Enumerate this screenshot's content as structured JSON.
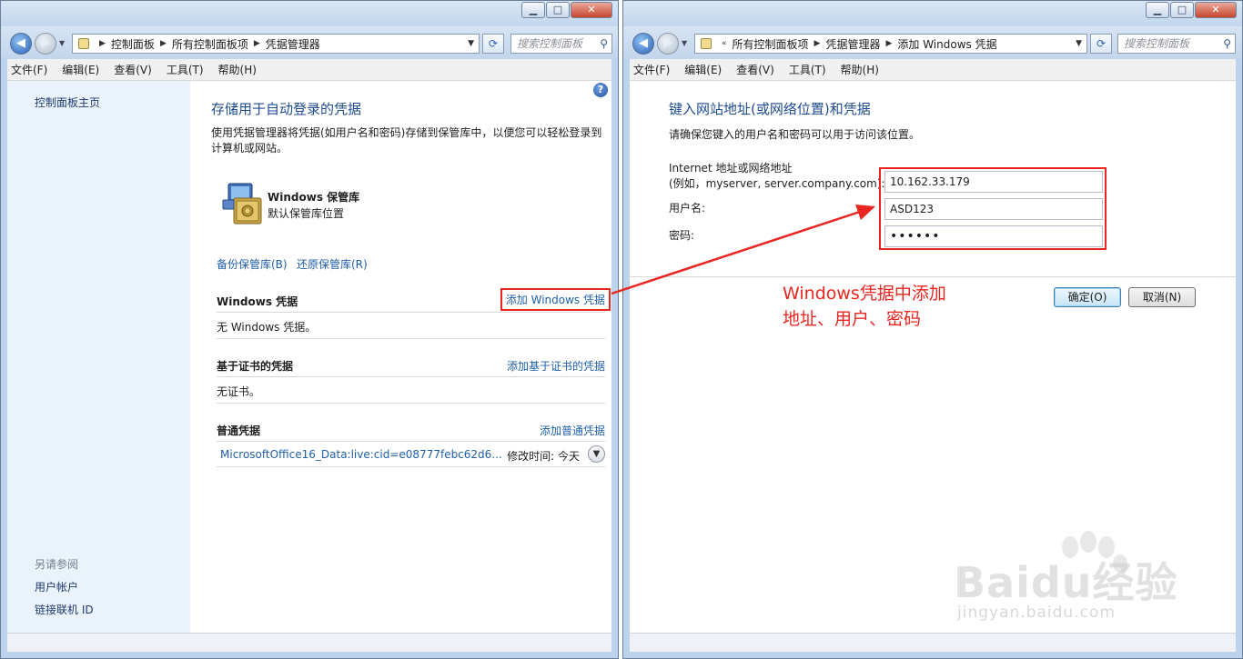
{
  "left_window": {
    "breadcrumb": [
      "控制面板",
      "所有控制面板项",
      "凭据管理器"
    ],
    "search_placeholder": "搜索控制面板",
    "menu": [
      "文件(F)",
      "编辑(E)",
      "查看(V)",
      "工具(T)",
      "帮助(H)"
    ],
    "sidebar": {
      "home": "控制面板主页",
      "see_also": "另请参阅",
      "links": [
        "用户帐户",
        "链接联机 ID"
      ]
    },
    "main": {
      "title": "存储用于自动登录的凭据",
      "description": "使用凭据管理器将凭据(如用户名和密码)存储到保管库中，以便您可以轻松登录到计算机或网站。",
      "vault_title": "Windows 保管库",
      "vault_subtitle": "默认保管库位置",
      "backup_link": "备份保管库(B)",
      "restore_link": "还原保管库(R)",
      "sections": [
        {
          "title": "Windows 凭据",
          "link": "添加 Windows 凭据",
          "body": "无 Windows 凭据。"
        },
        {
          "title": "基于证书的凭据",
          "link": "添加基于证书的凭据",
          "body": "无证书。"
        },
        {
          "title": "普通凭据",
          "link": "添加普通凭据",
          "item_name": "MicrosoftOffice16_Data:live:cid=e08777febc62d6...",
          "item_modified": "修改时间:  今天"
        }
      ]
    }
  },
  "right_window": {
    "breadcrumb_prefix": "«",
    "breadcrumb": [
      "所有控制面板项",
      "凭据管理器",
      "添加 Windows 凭据"
    ],
    "search_placeholder": "搜索控制面板",
    "menu": [
      "文件(F)",
      "编辑(E)",
      "查看(V)",
      "工具(T)",
      "帮助(H)"
    ],
    "title": "键入网站地址(或网络位置)和凭据",
    "description": "请确保您键入的用户名和密码可以用于访问该位置。",
    "address_label_line1": "Internet 地址或网络地址",
    "address_label_line2": "(例如，myserver, server.company.com):",
    "address_value": "10.162.33.179",
    "username_label": "用户名:",
    "username_value": "ASD123",
    "password_label": "密码:",
    "password_value": "••••••",
    "ok_button": "确定(O)",
    "cancel_button": "取消(N)",
    "annotation_line1": "Windows凭据中添加",
    "annotation_line2": "地址、用户、密码"
  },
  "watermark": {
    "brand": "Baidu经验",
    "sub": "jingyan.baidu.com"
  },
  "colors": {
    "highlight": "#e8261f",
    "link": "#1f5fa8",
    "heading": "#1e4b8f"
  }
}
